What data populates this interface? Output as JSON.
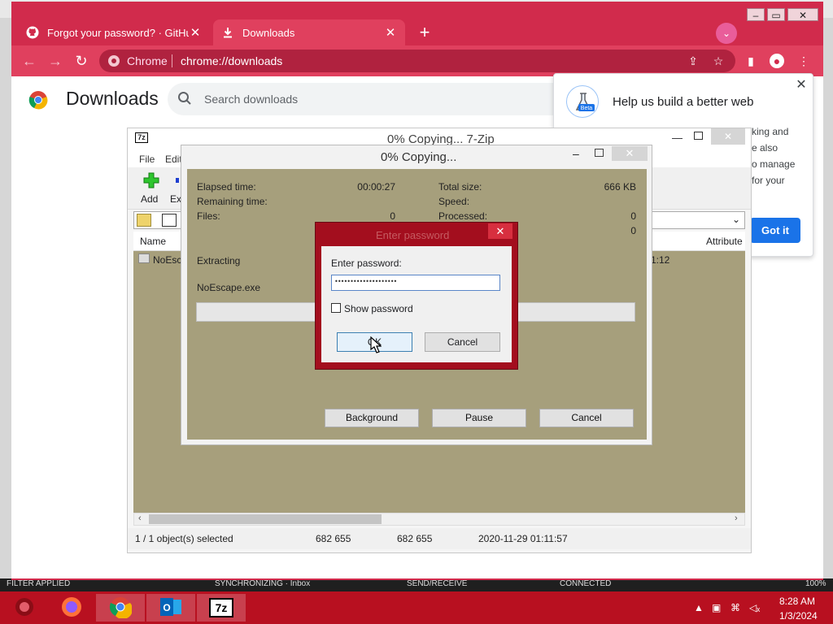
{
  "chrome": {
    "tabs": [
      {
        "title": "Forgot your password? · GitHub"
      },
      {
        "title": "Downloads"
      }
    ],
    "address": {
      "chip": "Chrome",
      "url_prefix": "chrome://",
      "url_bold": "downloads"
    }
  },
  "downloads_page": {
    "title": "Downloads",
    "search_placeholder": "Search downloads"
  },
  "help_popup": {
    "badge": "Beta",
    "title": "Help us build a better web",
    "lines": [
      "king and",
      "e also",
      "o manage",
      "for your"
    ],
    "button": "Got it"
  },
  "zip_main": {
    "title": "0% Copying... 7-Zip",
    "menu": [
      "File",
      "Edit"
    ],
    "tools": {
      "add": "Add",
      "extract": "Ext"
    },
    "columns": {
      "name": "Name",
      "attributes": "Attribute"
    },
    "row": {
      "name": "NoEsc",
      "time": "1:12"
    },
    "status": {
      "selected": "1 / 1 object(s) selected",
      "size": "682 655",
      "packed": "682 655",
      "modified": "2020-11-29 01:11:57"
    }
  },
  "copy_dialog": {
    "title": "0% Copying...",
    "labels": {
      "elapsed": "Elapsed time:",
      "remaining": "Remaining time:",
      "files": "Files:",
      "total_size": "Total size:",
      "speed": "Speed:",
      "processed": "Processed:"
    },
    "values": {
      "elapsed": "00:00:27",
      "files": "0",
      "total_size": "666 KB",
      "processed": "0",
      "extra": "0"
    },
    "action": "Extracting",
    "file": "NoEscape.exe",
    "progress": 0,
    "buttons": {
      "background": "Background",
      "pause": "Pause",
      "cancel": "Cancel"
    }
  },
  "password_dialog": {
    "title": "Enter password",
    "label": "Enter password:",
    "value": "••••••••••••••••••••",
    "show_password": "Show password",
    "ok": "OK",
    "cancel": "Cancel"
  },
  "background_bar": {
    "left": "FILTER APPLIED",
    "mid": "SYNCHRONIZING · Inbox",
    "send": "SEND/RECEIVE",
    "connected": "CONNECTED",
    "zoom": "100%"
  },
  "taskbar": {
    "time": "8:28 AM",
    "date": "1/3/2024",
    "apps": [
      "explorer-icon",
      "firefox-icon",
      "chrome-icon",
      "outlook-icon",
      "7zip-icon"
    ]
  },
  "colors": {
    "chrome_frame": "#d12b4c",
    "taskbar": "#b81020",
    "dialog_body": "#a69f7c",
    "accent_blue": "#1a73e8"
  }
}
